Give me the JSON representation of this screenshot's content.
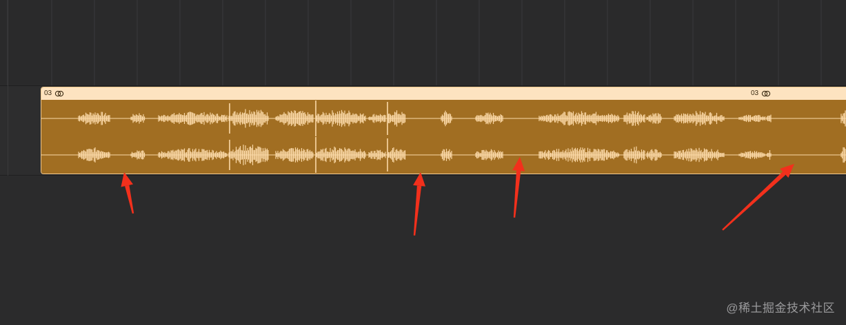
{
  "region": {
    "label_left": "03",
    "label_right": "03",
    "loop_icon": "loop-icon",
    "colors": {
      "header": "#fde3c0",
      "body": "#a16e22",
      "wave": "#fbd9a8"
    }
  },
  "annotations": {
    "arrow_color": "#f2301c",
    "arrow_count": 4
  },
  "watermark": {
    "text": "@稀土掘金技术社区"
  }
}
